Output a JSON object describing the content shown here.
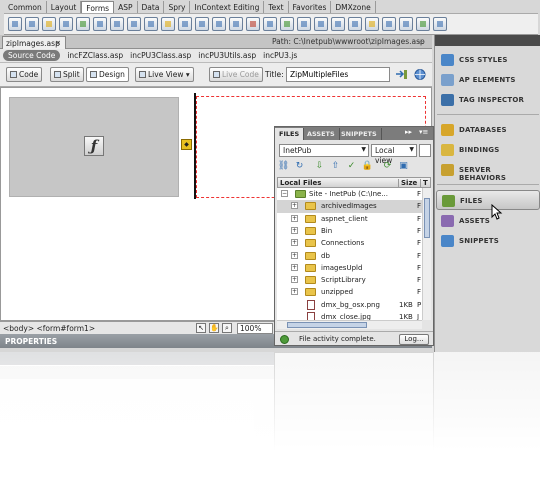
{
  "insert_tabs": [
    "Common",
    "Layout",
    "Forms",
    "ASP",
    "Data",
    "Spry",
    "InContext Editing",
    "Text",
    "Favorites",
    "DMXzone"
  ],
  "active_insert_tab": "Forms",
  "document": {
    "tab_label": "zipImages.asp",
    "path": "Path:  C:\\Inetpub\\wwwroot\\zipImages.asp",
    "related_files": [
      "Source Code",
      "incFZClass.asp",
      "incPU3Class.asp",
      "incPU3Utils.asp",
      "incPU3.js"
    ]
  },
  "toolbar": {
    "code": "Code",
    "split": "Split",
    "design": "Design",
    "live_view": "Live View",
    "live_code": "Live Code",
    "title_label": "Title:",
    "title_value": "ZipMultipleFiles"
  },
  "status_bar": {
    "tag_selector": "<body> <form#form1>",
    "zoom": "100%"
  },
  "properties_label": "PROPERTIES",
  "panels": {
    "top": [
      "CSS STYLES",
      "AP ELEMENTS",
      "TAG INSPECTOR"
    ],
    "middle": [
      "DATABASES",
      "BINDINGS",
      "SERVER BEHAVIORS"
    ],
    "bottom": [
      "FILES",
      "ASSETS",
      "SNIPPETS"
    ],
    "active": "FILES"
  },
  "files_panel": {
    "tabs": [
      "FILES",
      "ASSETS",
      "SNIPPETS"
    ],
    "site_select": "InetPub",
    "view_select": "Local view",
    "header_name": "Local Files",
    "header_size": "Size",
    "header_type": "T",
    "rows": [
      {
        "name": "Site - InetPub (C:\\Ine...",
        "size": "",
        "type": "F",
        "kind": "site",
        "expand": "−"
      },
      {
        "name": "archivedImages",
        "size": "",
        "type": "F",
        "kind": "folder",
        "expand": "+",
        "selected": true
      },
      {
        "name": "aspnet_client",
        "size": "",
        "type": "F",
        "kind": "folder",
        "expand": "+"
      },
      {
        "name": "Bin",
        "size": "",
        "type": "F",
        "kind": "folder",
        "expand": "+"
      },
      {
        "name": "Connections",
        "size": "",
        "type": "F",
        "kind": "folder",
        "expand": "+"
      },
      {
        "name": "db",
        "size": "",
        "type": "F",
        "kind": "folder",
        "expand": "+"
      },
      {
        "name": "imagesUpld",
        "size": "",
        "type": "F",
        "kind": "folder",
        "expand": "+"
      },
      {
        "name": "ScriptLibrary",
        "size": "",
        "type": "F",
        "kind": "folder",
        "expand": "+"
      },
      {
        "name": "unzipped",
        "size": "",
        "type": "F",
        "kind": "folder",
        "expand": "+"
      },
      {
        "name": "dmx_bg_osx.png",
        "size": "1KB",
        "type": "P",
        "kind": "file",
        "expand": ""
      },
      {
        "name": "dmx_close.jpg",
        "size": "1KB",
        "type": "J",
        "kind": "file",
        "expand": ""
      }
    ],
    "status_text": "File activity complete.",
    "log_button": "Log..."
  },
  "colors": {
    "accent_blue": "#2f6cb0",
    "folder_yellow": "#e9c44a",
    "form_outline_red": "#ee3333"
  },
  "icons": [
    "flash-movie-icon",
    "cursor-arrow-icon",
    "hand-icon",
    "zoom-icon",
    "file-activity-icon"
  ]
}
